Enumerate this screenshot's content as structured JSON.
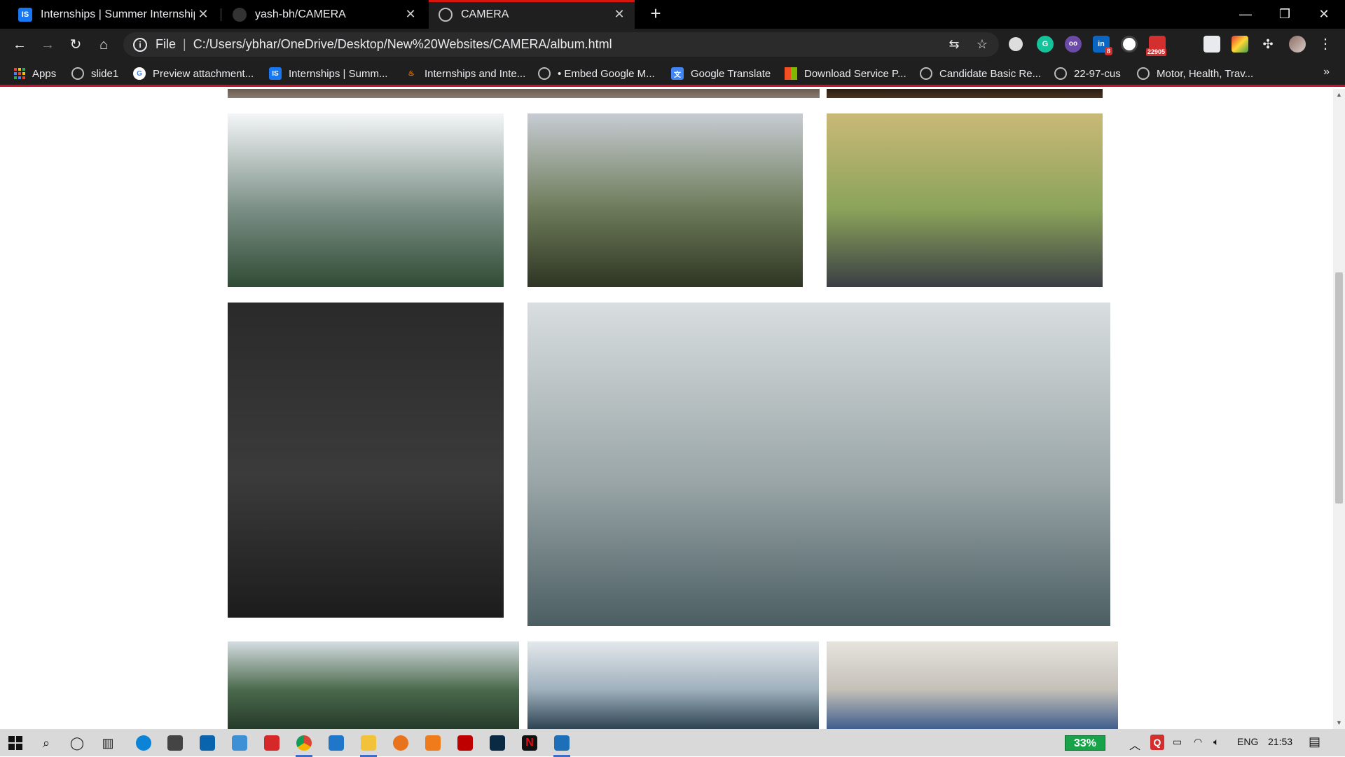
{
  "browser": {
    "tabs": [
      {
        "title": "Internships | Summer Internship",
        "favicon_text": "IS",
        "favicon_color": "#1877f2"
      },
      {
        "title": "yash-bh/CAMERA",
        "favicon_text": "",
        "favicon_color": "#333333"
      },
      {
        "title": "CAMERA",
        "favicon_text": "",
        "favicon_color": "#5f6368",
        "active": true
      }
    ],
    "new_tab_label": "+",
    "window_controls": {
      "minimize": "—",
      "restore": "❐",
      "close": "✕"
    },
    "address_bar": {
      "scheme": "File",
      "url": "C:/Users/ybhar/OneDrive/Desktop/New%20Websites/CAMERA/album.html"
    },
    "extensions": [
      {
        "name": "translate-icon",
        "label": ""
      },
      {
        "name": "bookmark-star-icon",
        "label": "☆"
      },
      {
        "name": "circle-ext-icon",
        "label": ""
      },
      {
        "name": "grammarly-icon",
        "label": "G"
      },
      {
        "name": "eyes-ext-icon",
        "label": "oo"
      },
      {
        "name": "linkedin-ext-icon",
        "label": "in",
        "badge": "8"
      },
      {
        "name": "timer-ext-icon",
        "label": ""
      },
      {
        "name": "mail-ext-icon",
        "label": "",
        "badge": "22905"
      },
      {
        "name": "instagram-ext-icon",
        "label": ""
      },
      {
        "name": "color-ext-icon",
        "label": ""
      },
      {
        "name": "puzzle-icon",
        "label": ""
      },
      {
        "name": "profile-avatar",
        "label": ""
      },
      {
        "name": "menu-kebab-icon",
        "label": "⋮"
      }
    ]
  },
  "bookmarks": [
    {
      "label": "Apps",
      "icon": "apps-grid-icon"
    },
    {
      "label": "slide1",
      "icon": "globe-icon"
    },
    {
      "label": "Preview attachment...",
      "icon": "google-icon"
    },
    {
      "label": "Internships | Summ...",
      "icon": "internshala-icon"
    },
    {
      "label": "Internships and Inte...",
      "icon": "flame-icon"
    },
    {
      "label": "• Embed Google M...",
      "icon": "globe-icon"
    },
    {
      "label": "Google Translate",
      "icon": "translate-icon"
    },
    {
      "label": "Download Service P...",
      "icon": "microsoft-icon"
    },
    {
      "label": "Candidate Basic Re...",
      "icon": "globe-icon"
    },
    {
      "label": "22-97-cus",
      "icon": "globe-icon"
    },
    {
      "label": "Motor, Health, Trav...",
      "icon": "globe-icon"
    }
  ],
  "bookmarks_more": "»",
  "gallery": {
    "photos": [
      {
        "name": "photo-top-left-partial",
        "colors": [
          "#6b5c52",
          "#8a7b6f"
        ]
      },
      {
        "name": "photo-top-right-partial",
        "colors": [
          "#2b1d12",
          "#4a3320"
        ]
      },
      {
        "name": "photo-redhead-mountains",
        "colors": [
          "#f4f6f8",
          "#7b8f86",
          "#2f4b34"
        ]
      },
      {
        "name": "photo-couple-cameras",
        "colors": [
          "#c7ccd3",
          "#6e7b5a",
          "#2e3523"
        ]
      },
      {
        "name": "photo-hijab-photographer",
        "colors": [
          "#c9b977",
          "#8ba35a",
          "#3b3e45"
        ]
      },
      {
        "name": "photo-man-brick-wall",
        "colors": [
          "#2a2a2a",
          "#3b3b3b",
          "#1c1c1c"
        ]
      },
      {
        "name": "photo-cafe-women-cameras",
        "colors": [
          "#d9dedf",
          "#9aa6a8",
          "#4b5e62"
        ]
      },
      {
        "name": "photo-mountain-climber",
        "colors": [
          "#d5dde2",
          "#4b6a4c",
          "#263a2a"
        ]
      },
      {
        "name": "photo-hooded-man",
        "colors": [
          "#e4e8ec",
          "#9fb0bd",
          "#2e4352"
        ]
      },
      {
        "name": "photo-jeans-tripod",
        "colors": [
          "#e6e3de",
          "#c5c0b8",
          "#3f5e8d"
        ]
      }
    ]
  },
  "taskbar": {
    "battery_percent": "33%",
    "language": "ENG",
    "time": "21:53",
    "apps": [
      {
        "name": "windows-start-icon"
      },
      {
        "name": "search-icon"
      },
      {
        "name": "cortana-icon"
      },
      {
        "name": "task-view-icon"
      },
      {
        "name": "edge-icon",
        "color": "#0b84d8"
      },
      {
        "name": "store-icon",
        "color": "#444"
      },
      {
        "name": "mail-icon",
        "color": "#0a64ad"
      },
      {
        "name": "file-icon",
        "color": "#3d8fd6"
      },
      {
        "name": "download-app-icon",
        "color": "#d62828"
      },
      {
        "name": "chrome-icon",
        "color": "#db4437"
      },
      {
        "name": "vscode-icon",
        "color": "#1f77c9"
      },
      {
        "name": "file-explorer-icon",
        "color": "#f2c23a"
      },
      {
        "name": "firefox-icon",
        "color": "#e8731c"
      },
      {
        "name": "sublime-icon",
        "color": "#ef7b1a"
      },
      {
        "name": "filezilla-icon",
        "color": "#bf0000"
      },
      {
        "name": "photoshop-icon",
        "color": "#0a2a44"
      },
      {
        "name": "netflix-icon",
        "color": "#111"
      },
      {
        "name": "photos-icon",
        "color": "#1c6fb8"
      }
    ]
  }
}
